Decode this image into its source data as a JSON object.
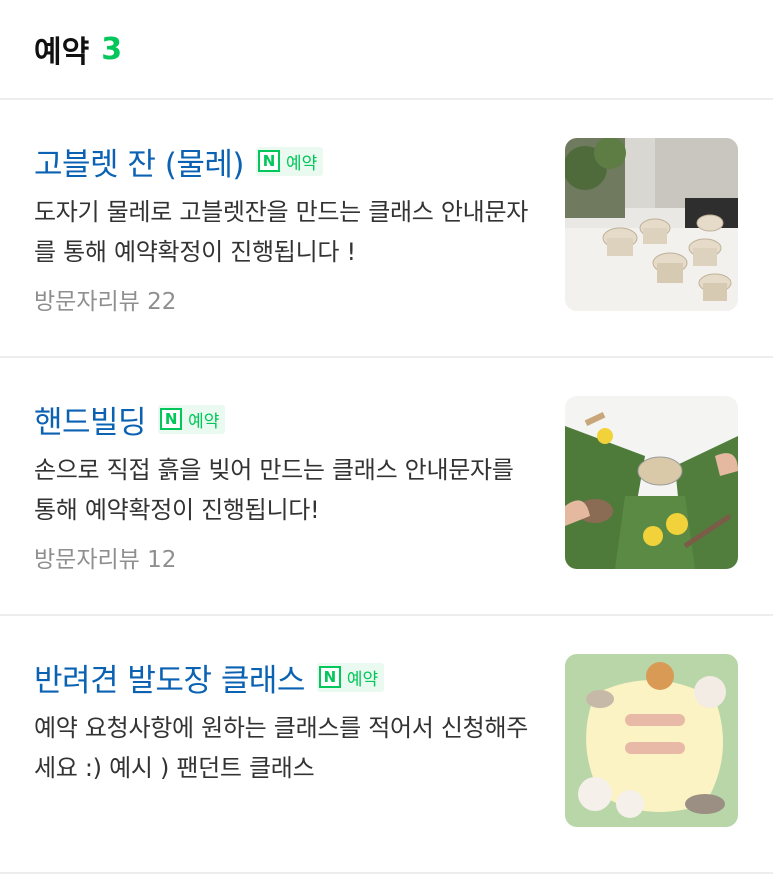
{
  "header": {
    "title": "예약",
    "count": "3"
  },
  "items": [
    {
      "name": "고블렛 잔 (물레)",
      "badge": "예약",
      "description": "도자기 물레로 고블렛잔을 만드는 클래스 안내문자를 통해 예약확정이 진행됩니다 !",
      "review": "방문자리뷰 22",
      "image": "pottery-goblets-photo"
    },
    {
      "name": "핸드빌딩",
      "badge": "예약",
      "description": "손으로 직접 흙을 빚어 만드는 클래스 안내문자를 통해 예약확정이 진행됩니다!",
      "review": "방문자리뷰 12",
      "image": "handbuilding-clay-photo"
    },
    {
      "name": "반려견 발도장 클래스",
      "badge": "예약",
      "description": "예약 요청사항에 원하는 클래스를 적어서 신청해주세요 :) 예시 ) 팬던트 클래스",
      "image": "dog-pawprint-poster"
    }
  ],
  "badge_icon": "naver-n-icon",
  "colors": {
    "accent": "#03c75a",
    "link": "#0b62b3",
    "muted": "#8f8f8f"
  }
}
